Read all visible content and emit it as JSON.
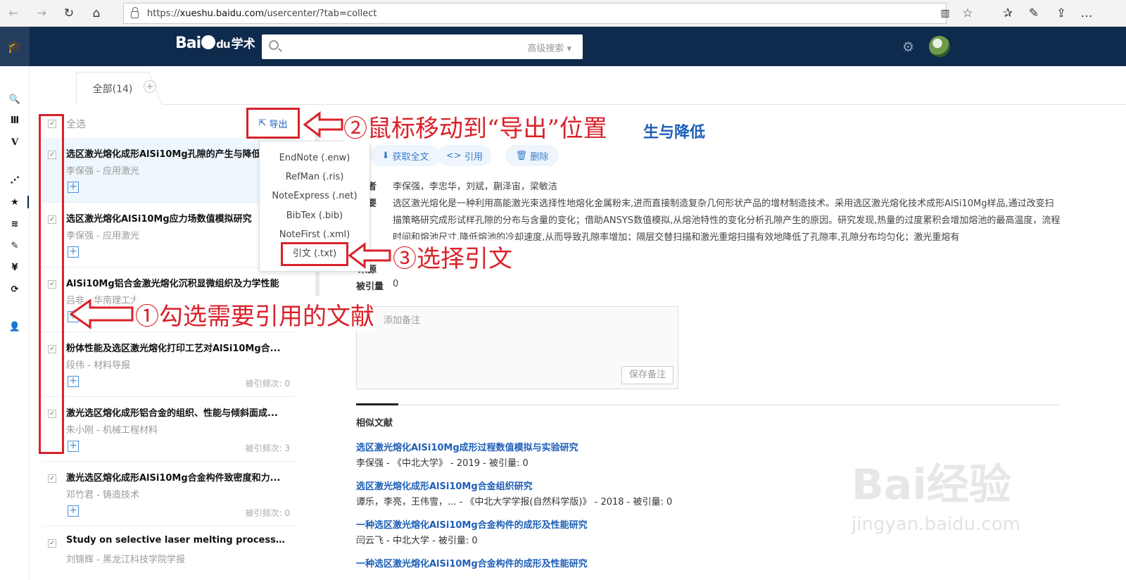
{
  "browser": {
    "url_prefix": "https://",
    "url_domain": "xueshu.baidu.com",
    "url_path": "/usercenter/?tab=collect"
  },
  "header": {
    "logo_bai": "Bai",
    "logo_du": "du",
    "logo_suffix": "学术",
    "advanced_search": "高级搜索"
  },
  "tabs": {
    "all": "全部(14)"
  },
  "list": {
    "select_all": "全选",
    "items": [
      {
        "title": "选区激光熔化成形AlSi10Mg孔隙的产生与降低",
        "meta": "李保强 - 应用激光",
        "cites": "被引"
      },
      {
        "title": "选区激光熔化AlSi10Mg应力场数值模拟研究",
        "meta": "李保强 - 应用激光",
        "cites": "被引"
      },
      {
        "title": "AlSi10Mg铝合金激光熔化沉积显微组织及力学性能",
        "meta": "吕非 - 华南理工大",
        "cites": ""
      },
      {
        "title": "粉体性能及选区激光熔化打印工艺对AlSi10Mg合...",
        "meta": "段伟 - 材料导报",
        "cites": "被引频次: 0"
      },
      {
        "title": "激光选区熔化成形铝合金的组织、性能与倾斜面成...",
        "meta": "朱小刚 - 机械工程材料",
        "cites": "被引频次: 3"
      },
      {
        "title": "激光选区熔化成形AlSi10Mg合金构件致密度和力...",
        "meta": "邓竹君 - 铸造技术",
        "cites": "被引频次: 0"
      },
      {
        "title": "Study on selective laser melting process and f...",
        "meta": "刘锦辉 - 黑龙江科技学院学报",
        "cites": ""
      }
    ]
  },
  "export": {
    "label": "导出",
    "options": [
      "EndNote (.enw)",
      "RefMan (.ris)",
      "NoteExpress (.net)",
      "BibTex (.bib)",
      "NoteFirst (.xml)",
      "引文 (.txt)"
    ]
  },
  "detail": {
    "title_tail": "生与降低",
    "get_full": "获取全文",
    "cite": "引用",
    "delete": "删除",
    "authors_label": "者",
    "authors": "李保强，李忠华，刘斌，蒯泽宙，梁敏洁",
    "abstract_label": "要",
    "abstract": "选区激光熔化是一种利用高能激光束选择性地熔化金属粉末,进而直接制造复杂几何形状产品的增材制造技术。采用选区激光熔化技术成形AlSi10Mg样品,通过改变扫描策略研究成形试样孔隙的分布与含量的变化；借助ANSYS数值模拟,从熔池特性的变化分析孔隙产生的原因。研究发现,热量的过度累积会增加熔池的最高温度，流程时间和熔池尺寸,降低熔池的冷却速度,从而导致孔隙率增加；隔层交替扫描和激光重熔扫描有效地降低了孔隙率,孔隙分布均匀化；激光重熔有",
    "source_label": "来源",
    "cited_label": "被引量",
    "cited_value": "0",
    "note_placeholder": "添加备注",
    "save_note": "保存备注",
    "similar_title": "相似文献",
    "similar": [
      {
        "title": "选区激光熔化AlSi10Mg成形过程数值模拟与实验研究",
        "meta": "李保强 - 《中北大学》 - 2019 - 被引量: 0"
      },
      {
        "title": "选区激光熔化成形AlSi10Mg合金组织研究",
        "meta": "谭乐，李亮，王伟雪，... - 《中北大学学报(自然科学版)》 - 2018 - 被引量: 0"
      },
      {
        "title": "一种选区激光熔化AlSi10Mg合金构件的成形及性能研究",
        "meta": "闫云飞 - 中北大学 - 被引量: 0"
      },
      {
        "title": "一种选区激光熔化AlSi10Mg合金构件的成形及性能研究",
        "meta": ""
      }
    ]
  },
  "annotations": {
    "step1": "①勾选需要引用的文献",
    "step2": "②鼠标移动到“导出”位置",
    "step3": "③选择引文"
  },
  "watermark": {
    "brand": "Bai经验",
    "site": "jingyan.baidu.com"
  },
  "colors": {
    "header": "#0e2a4d",
    "accent_red": "#d9222a",
    "link_blue": "#1d5fb8"
  }
}
